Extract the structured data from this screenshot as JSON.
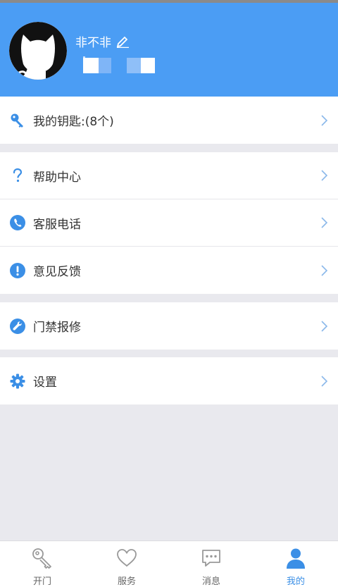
{
  "colors": {
    "brand": "#4b9df4",
    "accent": "#3b8fe6",
    "background": "#e9e9ee"
  },
  "profile": {
    "username": "非不非",
    "avatar_icon": "cat-silhouette-icon",
    "edit_icon": "pencil-icon"
  },
  "menu": {
    "keys": {
      "label": "我的钥匙:(8个)",
      "icon": "key-icon"
    },
    "help": {
      "label": "帮助中心",
      "icon": "question-icon"
    },
    "service": {
      "label": "客服电话",
      "icon": "phone-icon"
    },
    "feedback": {
      "label": "意见反馈",
      "icon": "exclamation-icon"
    },
    "repair": {
      "label": "门禁报修",
      "icon": "wrench-icon"
    },
    "settings": {
      "label": "设置",
      "icon": "gear-icon"
    }
  },
  "tabbar": {
    "tabs": [
      {
        "label": "开门",
        "icon": "key-outline-icon",
        "active": false
      },
      {
        "label": "服务",
        "icon": "heart-outline-icon",
        "active": false
      },
      {
        "label": "消息",
        "icon": "chat-bubble-icon",
        "active": false
      },
      {
        "label": "我的",
        "icon": "person-icon",
        "active": true
      }
    ]
  }
}
